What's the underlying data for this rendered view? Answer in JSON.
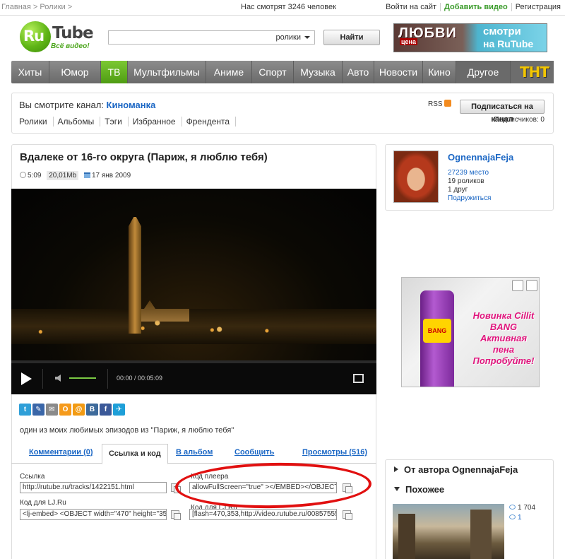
{
  "topbar": {
    "crumb_home": "Главная >",
    "crumb_videos": "Ролики >",
    "watching": "Нас смотрят 3246 человек",
    "login": "Войти на сайт",
    "add_video": "Добавить видео",
    "register": "Регистрация"
  },
  "logo": {
    "ru": "Ru",
    "tube": "Tube",
    "tagline": "Всё видео!"
  },
  "search": {
    "value": "",
    "scope": "ролики",
    "button": "Найти"
  },
  "banner": {
    "left_big": "ЛЮБВИ",
    "left_small": "цена",
    "right_1": "смотри",
    "right_2": "на RuTube"
  },
  "nav": {
    "items": [
      {
        "label": "Хиты"
      },
      {
        "label": "Юмор"
      },
      {
        "label": "ТВ"
      },
      {
        "label": "Мультфильмы"
      },
      {
        "label": "Аниме"
      },
      {
        "label": "Спорт"
      },
      {
        "label": "Музыка"
      },
      {
        "label": "Авто"
      },
      {
        "label": "Новости"
      },
      {
        "label": "Кино"
      },
      {
        "label": "Другое"
      }
    ],
    "active_index": 2,
    "tnt_logo": "ТНТ"
  },
  "channel": {
    "prefix": "Вы смотрите канал: ",
    "name": "Киноманка",
    "tabs": [
      "Ролики",
      "Альбомы",
      "Тэги",
      "Избранное",
      "Френдента"
    ],
    "rss": "RSS",
    "subscribe": "Подписаться на канал",
    "subscribers": "Подписчиков: 0"
  },
  "video": {
    "title": "Вдалеке от 16-го округа (Париж, я люблю тебя)",
    "duration": "5:09",
    "size": "20,01Mb",
    "date": "17 янв 2009",
    "player_time": "00:00 / 00:05:09",
    "description": "один из моих любимых эпизодов из \"Париж, я люблю тебя\""
  },
  "share_icons": [
    {
      "name": "twitter-icon",
      "glyph": "t",
      "color": "#2f9fd8"
    },
    {
      "name": "livejournal-icon",
      "glyph": "✎",
      "color": "#3a66a8"
    },
    {
      "name": "email-icon",
      "glyph": "✉",
      "color": "#8a8a8a"
    },
    {
      "name": "odnoklassniki-icon",
      "glyph": "O",
      "color": "#f59a1b"
    },
    {
      "name": "mailru-icon",
      "glyph": "@",
      "color": "#f29b13"
    },
    {
      "name": "vkontakte-icon",
      "glyph": "B",
      "color": "#3d6a9b"
    },
    {
      "name": "facebook-icon",
      "glyph": "f",
      "color": "#3b5998"
    },
    {
      "name": "yandex-icon",
      "glyph": "✈",
      "color": "#1e9fd8"
    }
  ],
  "tabs": {
    "comments": "Комментарии (0)",
    "link_code": "Ссылка и код",
    "album": "В альбом",
    "report": "Сообщить",
    "views": "Просмотры (516)"
  },
  "fields": {
    "link_label": "Ссылка",
    "link_value": "http://rutube.ru/tracks/1422151.html",
    "player_label": "Код плеера",
    "player_value": "allowFullScreen=\"true\" ></EMBED></OBJECT>",
    "lj_label": "Код для LJ.Ru",
    "lj_value": "<lj-embed> <OBJECT width=\"470\" height=\"353\"",
    "forum_label": "Код для LJ.Ru",
    "forum_value": "[flash=470,353,http://video.rutube.ru/00857555"
  },
  "author": {
    "name": "OgnennajaFeja",
    "place": "27239 место",
    "videos": "19 роликов",
    "friends": "1 друг",
    "befriend": "Подружиться"
  },
  "ad": {
    "text": "Новинка Cillit BANG Активная пена Попробуйте!",
    "can_label": "BANG"
  },
  "related": {
    "from_author": "От автора OgnennajaFeja",
    "similar": "Похожее",
    "views": "1 704",
    "comments": "1"
  },
  "colors": {
    "link": "#1a66c4",
    "accent_green": "#4e9c13",
    "annotation_red": "#e11010"
  }
}
